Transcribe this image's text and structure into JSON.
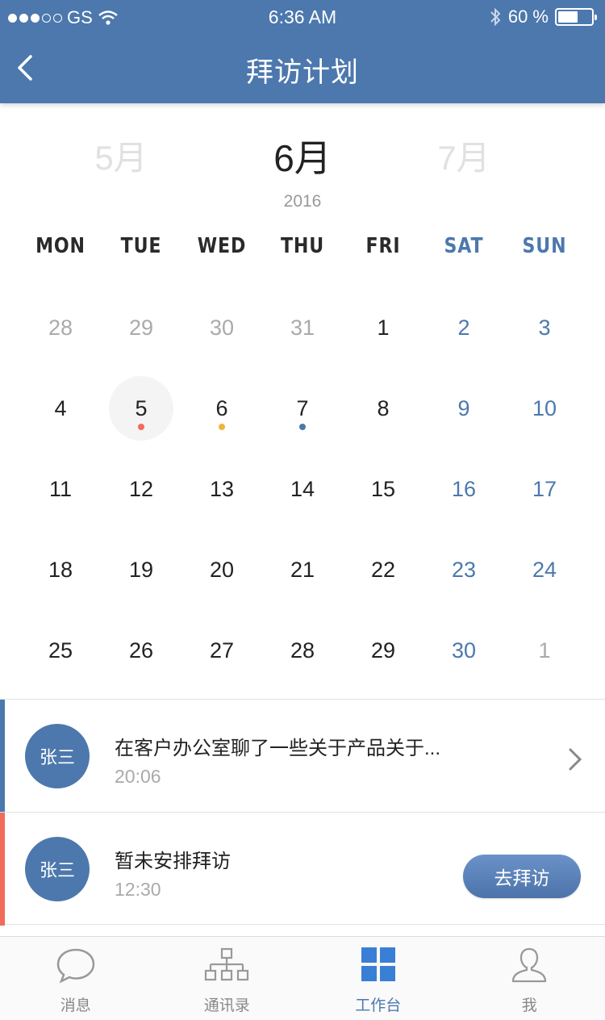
{
  "status": {
    "carrier": "GS",
    "time": "6:36 AM",
    "battery": "60 %",
    "battery_level": 0.6
  },
  "nav": {
    "title": "拜访计划"
  },
  "calendar": {
    "prev_month": "5月",
    "current_month": "6月",
    "next_month": "7月",
    "year": "2016",
    "weekdays": [
      "MON",
      "TUE",
      "WED",
      "THU",
      "FRI",
      "SAT",
      "SUN"
    ],
    "days": [
      {
        "d": "28",
        "other": true
      },
      {
        "d": "29",
        "other": true
      },
      {
        "d": "30",
        "other": true
      },
      {
        "d": "31",
        "other": true
      },
      {
        "d": "1"
      },
      {
        "d": "2"
      },
      {
        "d": "3"
      },
      {
        "d": "4"
      },
      {
        "d": "5",
        "selected": true,
        "mark": "#f26c5a"
      },
      {
        "d": "6",
        "mark": "#f0b33a"
      },
      {
        "d": "7",
        "mark": "#4c78ad"
      },
      {
        "d": "8"
      },
      {
        "d": "9"
      },
      {
        "d": "10"
      },
      {
        "d": "11"
      },
      {
        "d": "12"
      },
      {
        "d": "13"
      },
      {
        "d": "14"
      },
      {
        "d": "15"
      },
      {
        "d": "16"
      },
      {
        "d": "17"
      },
      {
        "d": "18"
      },
      {
        "d": "19"
      },
      {
        "d": "20"
      },
      {
        "d": "21"
      },
      {
        "d": "22"
      },
      {
        "d": "23"
      },
      {
        "d": "24"
      },
      {
        "d": "25"
      },
      {
        "d": "26"
      },
      {
        "d": "27"
      },
      {
        "d": "28"
      },
      {
        "d": "29"
      },
      {
        "d": "30"
      },
      {
        "d": "1",
        "other": true
      }
    ]
  },
  "visits": [
    {
      "avatar": "张三",
      "text": "在客户办公室聊了一些关于产品关于...",
      "time": "20:06",
      "bar_color": "#4c78ad"
    },
    {
      "avatar": "张三",
      "text": "暂未安排拜访",
      "time": "12:30",
      "bar_color": "#f26c5a",
      "button": "去拜访"
    }
  ],
  "tabs": [
    {
      "label": "消息",
      "icon": "chat-bubble-icon"
    },
    {
      "label": "通讯录",
      "icon": "org-chart-icon"
    },
    {
      "label": "工作台",
      "icon": "grid-icon",
      "active": true
    },
    {
      "label": "我",
      "icon": "person-icon"
    }
  ],
  "colors": {
    "primary": "#4c78ad",
    "accent_red": "#f26c5a",
    "accent_yellow": "#f0b33a"
  }
}
